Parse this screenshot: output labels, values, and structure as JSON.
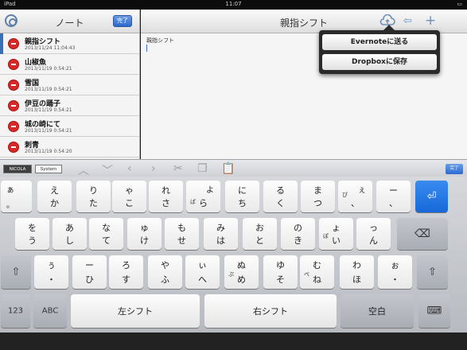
{
  "status": {
    "device": "iPad",
    "time": "11:07",
    "battery": "100%"
  },
  "sidebar": {
    "title": "ノート",
    "done_label": "完了",
    "notes": [
      {
        "title": "親指シフト",
        "date": "2013/11/24 11:04:43"
      },
      {
        "title": "山椒魚",
        "date": "2013/11/19 0:54:21"
      },
      {
        "title": "雪国",
        "date": "2013/11/19 0:54:21"
      },
      {
        "title": "伊豆の踊子",
        "date": "2013/11/19 0:54:21"
      },
      {
        "title": "城の崎にて",
        "date": "2013/11/19 0:54:21"
      },
      {
        "title": "刺青",
        "date": "2013/11/19 0:54:20"
      }
    ]
  },
  "editor": {
    "title": "親指シフト",
    "body": "親指シフト"
  },
  "share_menu": {
    "evernote": "Evernoteに送る",
    "dropbox": "Dropboxに保存"
  },
  "accessory": {
    "mode_a": "NICOLA",
    "mode_b": "System",
    "done_label": "完了"
  },
  "keyboard": {
    "row1": [
      {
        "tl": "ぁ",
        "bl": "。"
      },
      {
        "tc": "え",
        "bc": "か"
      },
      {
        "tc": "り",
        "bc": "た"
      },
      {
        "tc": "ゃ",
        "bc": "こ"
      },
      {
        "tc": "れ",
        "bc": "さ"
      },
      {
        "tr": "よ",
        "bl": "ぱ",
        "bc": "ら"
      },
      {
        "tc": "に",
        "bc": "ち"
      },
      {
        "tc": "る",
        "bc": "く"
      },
      {
        "tc": "ま",
        "bc": "つ"
      },
      {
        "tr": "ぇ",
        "tl": "ぴ",
        "bc": "、"
      },
      {
        "tc": "ー",
        "bc": "、"
      }
    ],
    "row2": [
      {
        "tc": "を",
        "bc": "う"
      },
      {
        "tc": "あ",
        "bc": "し"
      },
      {
        "tc": "な",
        "bc": "て"
      },
      {
        "tc": "ゅ",
        "bc": "け"
      },
      {
        "tc": "も",
        "bc": "せ"
      },
      {
        "tc": "み",
        "bc": "は"
      },
      {
        "tc": "お",
        "bc": "と"
      },
      {
        "tc": "の",
        "bc": "き"
      },
      {
        "tc": "ょ",
        "tl": "ぽ",
        "bc": "い"
      },
      {
        "tc": "っ",
        "bc": "ん"
      }
    ],
    "row3": [
      {
        "tc": "ぅ",
        "bc": "・"
      },
      {
        "tc": "ー",
        "bc": "ひ"
      },
      {
        "tc": "ろ",
        "bc": "す"
      },
      {
        "tc": "や",
        "bc": "ふ"
      },
      {
        "tc": "ぃ",
        "bc": "へ"
      },
      {
        "tc": "ぬ",
        "tl": "ぷ",
        "bc": "め"
      },
      {
        "tc": "ゆ",
        "bc": "そ"
      },
      {
        "tc": "む",
        "tl": "ぺ",
        "bc": "ね"
      },
      {
        "tc": "わ",
        "bc": "ほ"
      },
      {
        "tc": "ぉ",
        "bc": "・"
      }
    ],
    "num_label": "123",
    "abc_label": "ABC",
    "left_shift": "左シフト",
    "right_shift": "右シフト",
    "space_label": "空白",
    "return_glyph": "⏎",
    "backspace_glyph": "⌫",
    "shift_glyph": "⇧"
  }
}
